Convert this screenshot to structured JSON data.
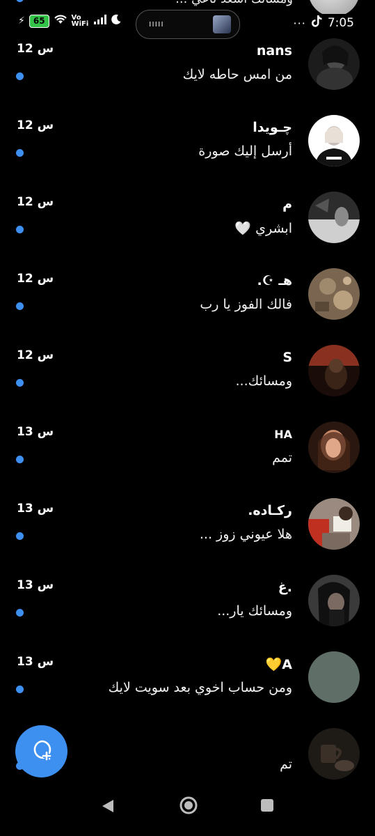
{
  "status_bar": {
    "battery": "65",
    "network_label": "Vo WiFi",
    "pill_indicator": "ııııı",
    "more": "···",
    "time": "7:05"
  },
  "clipped_previous": {
    "text": "ومسائك اسعد ناعي ..."
  },
  "conversations": [
    {
      "name": "nans",
      "preview": "من امس حاطه لايك",
      "time": "12 س",
      "unread": true,
      "avatar_color": "#2b2b2b"
    },
    {
      "name": "چـويدا",
      "preview": "أرسل إليك صورة",
      "time": "12 س",
      "unread": true,
      "avatar_color": "#ffffff"
    },
    {
      "name": "م",
      "preview": "ابشري 🤍",
      "time": "12 س",
      "unread": true,
      "avatar_color": "#3a3a3a"
    },
    {
      "name": "هـ ☪︎.",
      "preview": "فالك الفوز يا رب",
      "time": "12 س",
      "unread": true,
      "avatar_color": "#6b5a48"
    },
    {
      "name": "S",
      "preview": "ومسائك...",
      "time": "12 س",
      "unread": true,
      "avatar_color": "#5a2a20"
    },
    {
      "name": "HA",
      "preview": "تمم",
      "time": "13 س",
      "unread": true,
      "avatar_color": "#6a3a2a"
    },
    {
      "name": "ركـاده.",
      "preview": "هلا عيوني زوز ...",
      "time": "13 س",
      "unread": true,
      "avatar_color": "#8a7a70"
    },
    {
      "name": ".غ",
      "preview": "ومسائك يار...",
      "time": "13 س",
      "unread": true,
      "avatar_color": "#1e1e1e"
    },
    {
      "name": "A💛",
      "preview": "ومن حساب اخوي بعد سويت لايك",
      "time": "13 س",
      "unread": true,
      "avatar_color": "#5f6e66"
    },
    {
      "name": "",
      "preview": "تم",
      "time": "",
      "unread": true,
      "avatar_color": "#2a2420"
    }
  ],
  "fab": {
    "icon": "new-message-plus-icon",
    "color": "#3d8ff0"
  },
  "nav": {
    "back": "back-triangle-icon",
    "home": "home-circle-icon",
    "recent": "recent-square-icon"
  },
  "colors": {
    "accent": "#3d8ff0",
    "background": "#000000"
  }
}
